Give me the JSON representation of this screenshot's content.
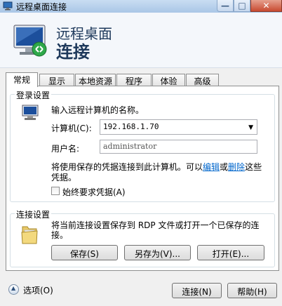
{
  "window": {
    "title": "远程桌面连接",
    "min_glyph": "—",
    "max_glyph": "□",
    "close_glyph": "✕"
  },
  "header": {
    "line1": "远程桌面",
    "line2": "连接"
  },
  "tabs": [
    "常规",
    "显示",
    "本地资源",
    "程序",
    "体验",
    "高级"
  ],
  "active_tab": "常规",
  "login": {
    "legend": "登录设置",
    "prompt": "输入远程计算机的名称。",
    "computer_label": "计算机(C):",
    "computer_value": "192.168.1.70",
    "user_label": "用户名:",
    "user_value": "administrator",
    "info_pre": "将使用保存的凭据连接到此计算机。可以",
    "info_edit": "编辑",
    "info_or": "或",
    "info_delete": "删除",
    "info_post": "这些",
    "info_line2": "凭据。",
    "always_ask": "始终要求凭据(A)"
  },
  "conn": {
    "legend": "连接设置",
    "desc_line1": "将当前连接设置保存到 RDP 文件或打开一个已保存的连",
    "desc_line2": "接。",
    "save": "保存(S)",
    "save_as": "另存为(V)...",
    "open": "打开(E)..."
  },
  "footer": {
    "options": "选项(O)",
    "connect": "连接(N)",
    "help": "帮助(H)"
  }
}
